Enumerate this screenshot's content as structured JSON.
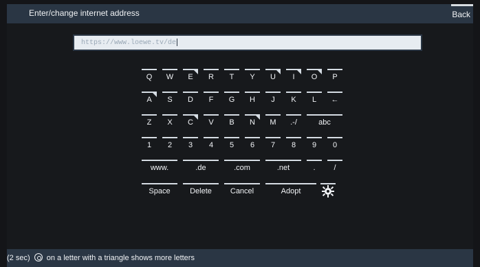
{
  "header": {
    "title": "Enter/change internet address",
    "back_label": "Back"
  },
  "url_input": {
    "value": "https://www.loewe.tv/de"
  },
  "keyboard": {
    "rows": [
      [
        {
          "label": "Q",
          "triangle": false
        },
        {
          "label": "W",
          "triangle": false
        },
        {
          "label": "E",
          "triangle": true
        },
        {
          "label": "R",
          "triangle": false
        },
        {
          "label": "T",
          "triangle": false
        },
        {
          "label": "Y",
          "triangle": false
        },
        {
          "label": "U",
          "triangle": true
        },
        {
          "label": "I",
          "triangle": true
        },
        {
          "label": "O",
          "triangle": true
        },
        {
          "label": "P",
          "triangle": false
        }
      ],
      [
        {
          "label": "A",
          "triangle": true
        },
        {
          "label": "S",
          "triangle": false
        },
        {
          "label": "D",
          "triangle": false
        },
        {
          "label": "F",
          "triangle": false
        },
        {
          "label": "G",
          "triangle": false
        },
        {
          "label": "H",
          "triangle": false
        },
        {
          "label": "J",
          "triangle": false
        },
        {
          "label": "K",
          "triangle": false
        },
        {
          "label": "L",
          "triangle": false
        },
        {
          "label": "←",
          "triangle": false
        }
      ],
      [
        {
          "label": "Z",
          "triangle": false
        },
        {
          "label": "X",
          "triangle": false
        },
        {
          "label": "C",
          "triangle": true
        },
        {
          "label": "V",
          "triangle": false
        },
        {
          "label": "B",
          "triangle": false
        },
        {
          "label": "N",
          "triangle": true
        },
        {
          "label": "M",
          "triangle": false
        },
        {
          "label": ".-/",
          "triangle": false
        },
        {
          "label": "abc",
          "triangle": false
        }
      ],
      [
        {
          "label": "1",
          "triangle": false
        },
        {
          "label": "2",
          "triangle": false
        },
        {
          "label": "3",
          "triangle": false
        },
        {
          "label": "4",
          "triangle": false
        },
        {
          "label": "5",
          "triangle": false
        },
        {
          "label": "6",
          "triangle": false
        },
        {
          "label": "7",
          "triangle": false
        },
        {
          "label": "8",
          "triangle": false
        },
        {
          "label": "9",
          "triangle": false
        },
        {
          "label": "0",
          "triangle": false
        }
      ],
      [
        {
          "label": "www.",
          "triangle": false
        },
        {
          "label": ".de",
          "triangle": false
        },
        {
          "label": ".com",
          "triangle": false
        },
        {
          "label": ".net",
          "triangle": false
        },
        {
          "label": ".",
          "triangle": false
        },
        {
          "label": "/",
          "triangle": false
        }
      ],
      [
        {
          "label": "Space",
          "triangle": false
        },
        {
          "label": "Delete",
          "triangle": false
        },
        {
          "label": "Cancel",
          "triangle": false
        },
        {
          "label": "Adopt",
          "triangle": false
        }
      ]
    ],
    "settings_icon": "gear-icon"
  },
  "status": {
    "prefix": "(2 sec)",
    "suffix": "on a letter with a triangle shows more letters",
    "icon": "ok-button-icon"
  }
}
